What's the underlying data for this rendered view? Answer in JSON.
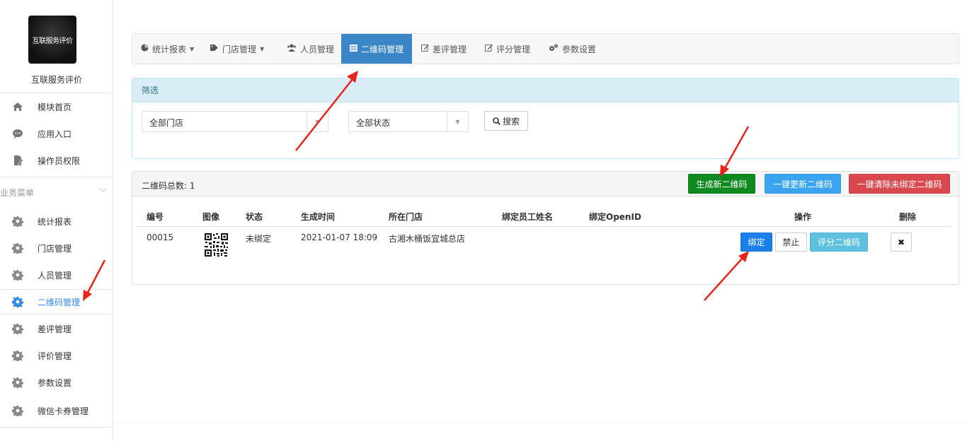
{
  "sidebar": {
    "logo_text": "互联服务评价",
    "app_name": "互联服务评价",
    "top_items": [
      {
        "label": "模块首页",
        "icon": "home-icon"
      },
      {
        "label": "应用入口",
        "icon": "chat-bubble-icon"
      },
      {
        "label": "操作员权限",
        "icon": "document-edit-icon"
      }
    ],
    "section_title": "业务菜单",
    "section_chevron": "﹀",
    "business_items": [
      {
        "label": "统计报表",
        "icon": "gear-icon"
      },
      {
        "label": "门店管理",
        "icon": "gear-icon"
      },
      {
        "label": "人员管理",
        "icon": "gear-icon"
      },
      {
        "label": "二维码管理",
        "icon": "gear-icon",
        "active": true
      },
      {
        "label": "差评管理",
        "icon": "gear-icon"
      },
      {
        "label": "评价管理",
        "icon": "gear-icon"
      },
      {
        "label": "参数设置",
        "icon": "gear-icon"
      },
      {
        "label": "微信卡券管理",
        "icon": "gear-icon"
      }
    ],
    "active_color": "#3189e8"
  },
  "nav": {
    "items": [
      {
        "label": "统计报表",
        "icon": "pie-chart-icon",
        "caret": "▼"
      },
      {
        "label": "门店管理",
        "icon": "tag-icon",
        "caret": "▼"
      },
      {
        "label": "人员管理",
        "icon": "users-icon"
      },
      {
        "label": "二维码管理",
        "icon": "barcode-icon",
        "active": true
      },
      {
        "label": "差评管理",
        "icon": "edit-icon"
      },
      {
        "label": "评分管理",
        "icon": "edit-icon"
      },
      {
        "label": "参数设置",
        "icon": "cogs-icon"
      }
    ],
    "active_bg": "#3b86c6"
  },
  "filter": {
    "title": "筛选",
    "store_select": "全部门店",
    "status_select": "全部状态",
    "search_label": "搜索",
    "search_icon": "magnifier-icon"
  },
  "list": {
    "count_label": "二维码总数: 1",
    "btn_generate": "生成新二维码",
    "btn_update_all": "一键更新二维码",
    "btn_clear_unbound": "一键清除未绑定二维码",
    "columns": {
      "id": "编号",
      "image": "图像",
      "status": "状态",
      "created": "生成时间",
      "store": "所在门店",
      "employee": "绑定员工姓名",
      "openid": "绑定OpenID",
      "actions": "操作",
      "delete": "删除"
    },
    "rows": [
      {
        "id": "00015",
        "status": "未绑定",
        "created": "2021-01-07 18:09",
        "store": "古湘木桶饭宜城总店",
        "employee": "",
        "openid": "",
        "btn_bind": "绑定",
        "btn_disable": "禁止",
        "btn_score_qr": "评分二维码",
        "delete_symbol": "✖"
      }
    ]
  },
  "colors": {
    "green": "#0f8a1f",
    "blue": "#3ba4f0",
    "red": "#d9484c",
    "annotation_arrow": "#e8231b"
  }
}
